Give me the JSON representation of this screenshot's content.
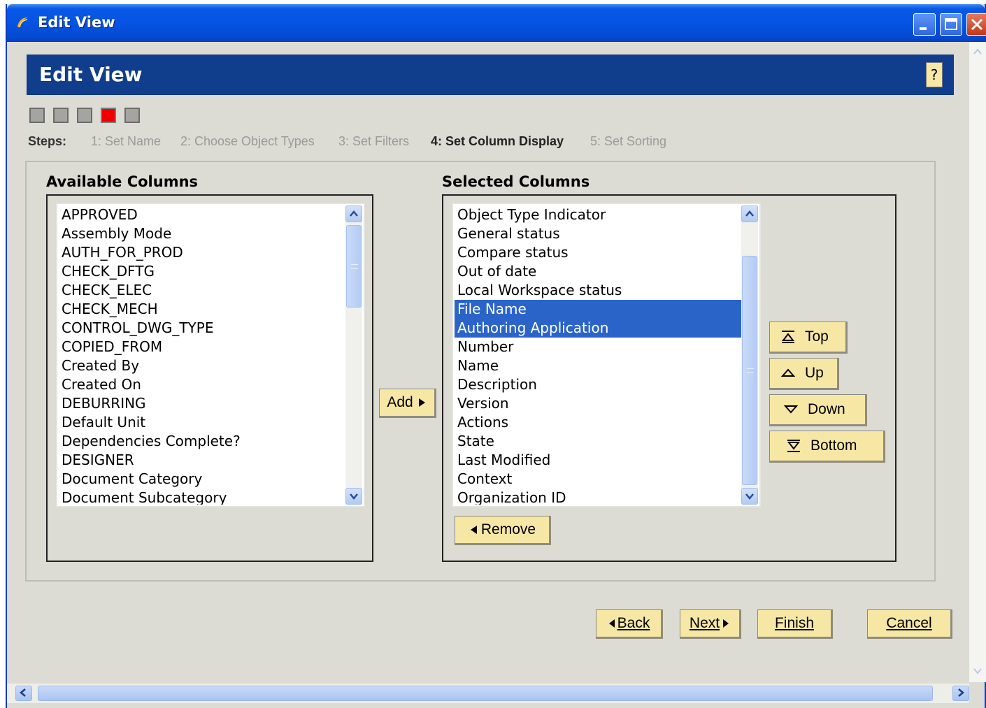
{
  "window": {
    "title": "Edit View",
    "minimize": "_",
    "maximize": "□",
    "close": "✕"
  },
  "header": {
    "title": "Edit View",
    "help_label": "?"
  },
  "steps": {
    "label": "Steps:",
    "current_index": 4,
    "items": [
      "1: Set Name",
      "2: Choose Object Types",
      "3: Set Filters",
      "4: Set Column Display",
      "5: Set Sorting"
    ]
  },
  "available": {
    "title": "Available Columns",
    "items": [
      "APPROVED",
      "Assembly Mode",
      "AUTH_FOR_PROD",
      "CHECK_DFTG",
      "CHECK_ELEC",
      "CHECK_MECH",
      "CONTROL_DWG_TYPE",
      "COPIED_FROM",
      "Created By",
      "Created On",
      "DEBURRING",
      "Default Unit",
      "Dependencies Complete?",
      "DESIGNER",
      "Document Category",
      "Document Subcategory"
    ]
  },
  "selected": {
    "title": "Selected Columns",
    "items": [
      "Object Type Indicator",
      "General status",
      "Compare status",
      "Out of date",
      "Local Workspace status",
      "File Name",
      "Authoring Application",
      "Number",
      "Name",
      "Description",
      "Version",
      "Actions",
      "State",
      "Last Modified",
      "Context",
      "Organization ID"
    ],
    "selected_items": [
      "File Name",
      "Authoring Application"
    ]
  },
  "buttons": {
    "add": "Add",
    "remove": "Remove",
    "top": "Top",
    "up": "Up",
    "down": "Down",
    "bottom": "Bottom",
    "back": "Back",
    "next": "Next",
    "finish": "Finish",
    "cancel": "Cancel"
  },
  "icons": {
    "title": "ptc-logo-icon",
    "add": "triangle-right-icon",
    "remove": "triangle-left-icon",
    "top": "move-top-icon",
    "up": "move-up-icon",
    "down": "move-down-icon",
    "bottom": "move-bottom-icon"
  },
  "colors": {
    "titlebar": "#0553e2",
    "header_band": "#103d8c",
    "button_fill": "#f6e7a5",
    "selection": "#2b64c8",
    "current_step": "#ef0000",
    "background": "#dcdbd4"
  }
}
